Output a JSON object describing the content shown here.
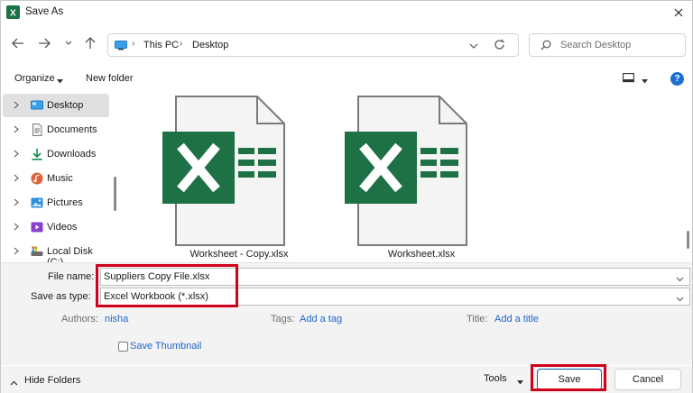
{
  "window": {
    "title": "Save As"
  },
  "nav": {
    "breadcrumb": [
      "This PC",
      "Desktop"
    ],
    "search_placeholder": "Search Desktop"
  },
  "commands": {
    "organize": "Organize",
    "new_folder": "New folder"
  },
  "sidebar": {
    "items": [
      {
        "label": "Desktop",
        "icon": "desktop-icon",
        "selected": true
      },
      {
        "label": "Documents",
        "icon": "documents-icon"
      },
      {
        "label": "Downloads",
        "icon": "downloads-icon"
      },
      {
        "label": "Music",
        "icon": "music-icon"
      },
      {
        "label": "Pictures",
        "icon": "pictures-icon"
      },
      {
        "label": "Videos",
        "icon": "videos-icon"
      },
      {
        "label": "Local Disk (C:)",
        "icon": "local-disk-icon"
      }
    ]
  },
  "files": [
    {
      "name": "Worksheet - Copy.xlsx",
      "icon": "excel-file-icon"
    },
    {
      "name": "Worksheet.xlsx",
      "icon": "excel-file-icon"
    }
  ],
  "form": {
    "file_name_label": "File name:",
    "file_name_value": "Suppliers Copy File.xlsx",
    "save_type_label": "Save as type:",
    "save_type_value": "Excel Workbook (*.xlsx)",
    "authors_label": "Authors:",
    "authors_value": "nisha",
    "tags_label": "Tags:",
    "tags_value": "Add a tag",
    "title_label": "Title:",
    "title_value": "Add a title",
    "save_thumbnail_label": "Save Thumbnail",
    "save_thumbnail_checked": false
  },
  "footer": {
    "hide_folders": "Hide Folders",
    "tools": "Tools",
    "save": "Save",
    "cancel": "Cancel"
  },
  "colors": {
    "excel_green": "#1e7145",
    "accent_blue": "#1e66c8",
    "highlight_red": "#d0021b"
  }
}
